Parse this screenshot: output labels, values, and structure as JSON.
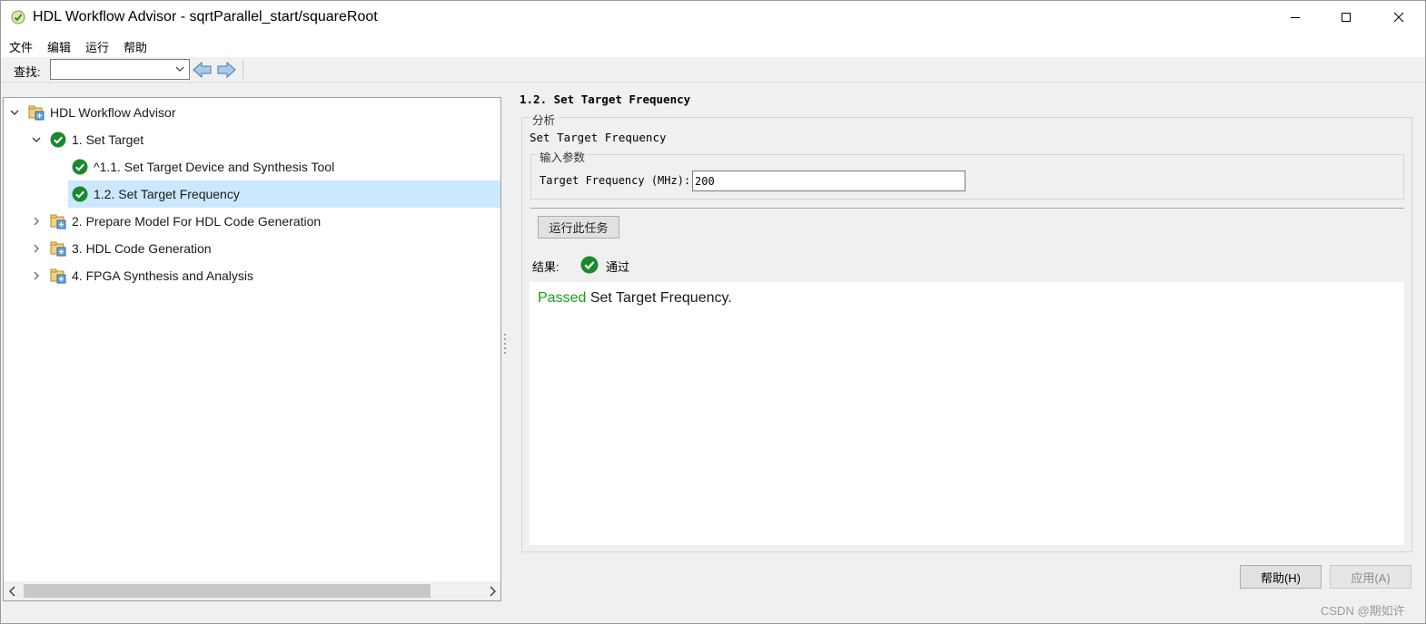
{
  "window": {
    "title": "HDL Workflow Advisor - sqrtParallel_start/squareRoot"
  },
  "menu": {
    "items": [
      "文件",
      "编辑",
      "运行",
      "帮助"
    ]
  },
  "toolbar": {
    "find_label": "查找:",
    "find_value": ""
  },
  "tree": {
    "items": [
      {
        "label": "HDL Workflow Advisor",
        "icon": "folder-tasks-icon",
        "expanded": true
      },
      {
        "label": "1. Set Target",
        "icon": "check-circle-icon",
        "expanded": true
      },
      {
        "label": "^1.1. Set Target Device and Synthesis Tool",
        "icon": "check-circle-icon"
      },
      {
        "label": "1.2. Set Target Frequency",
        "icon": "check-circle-icon",
        "selected": true
      },
      {
        "label": "2. Prepare Model For HDL Code Generation",
        "icon": "folder-tasks-icon",
        "expanded": false
      },
      {
        "label": "3. HDL Code Generation",
        "icon": "folder-tasks-icon",
        "expanded": false
      },
      {
        "label": "4. FPGA Synthesis and Analysis",
        "icon": "folder-tasks-icon",
        "expanded": false
      }
    ]
  },
  "task": {
    "heading": "1.2. Set Target Frequency",
    "analysis_legend": "分析",
    "description": "Set Target Frequency",
    "params_legend": "输入参数",
    "param_label": "Target Frequency (MHz):",
    "param_value": "200",
    "run_button": "运行此任务",
    "result_label": "结果:",
    "result_status": "通过",
    "report_passed": "Passed",
    "report_rest": " Set Target Frequency."
  },
  "buttons": {
    "help": "帮助(H)",
    "apply": "应用(A)"
  },
  "watermark": "CSDN @期如许",
  "colors": {
    "selection": "#cce8ff",
    "passed_green": "#16a116",
    "check_green": "#1a8a2e"
  }
}
